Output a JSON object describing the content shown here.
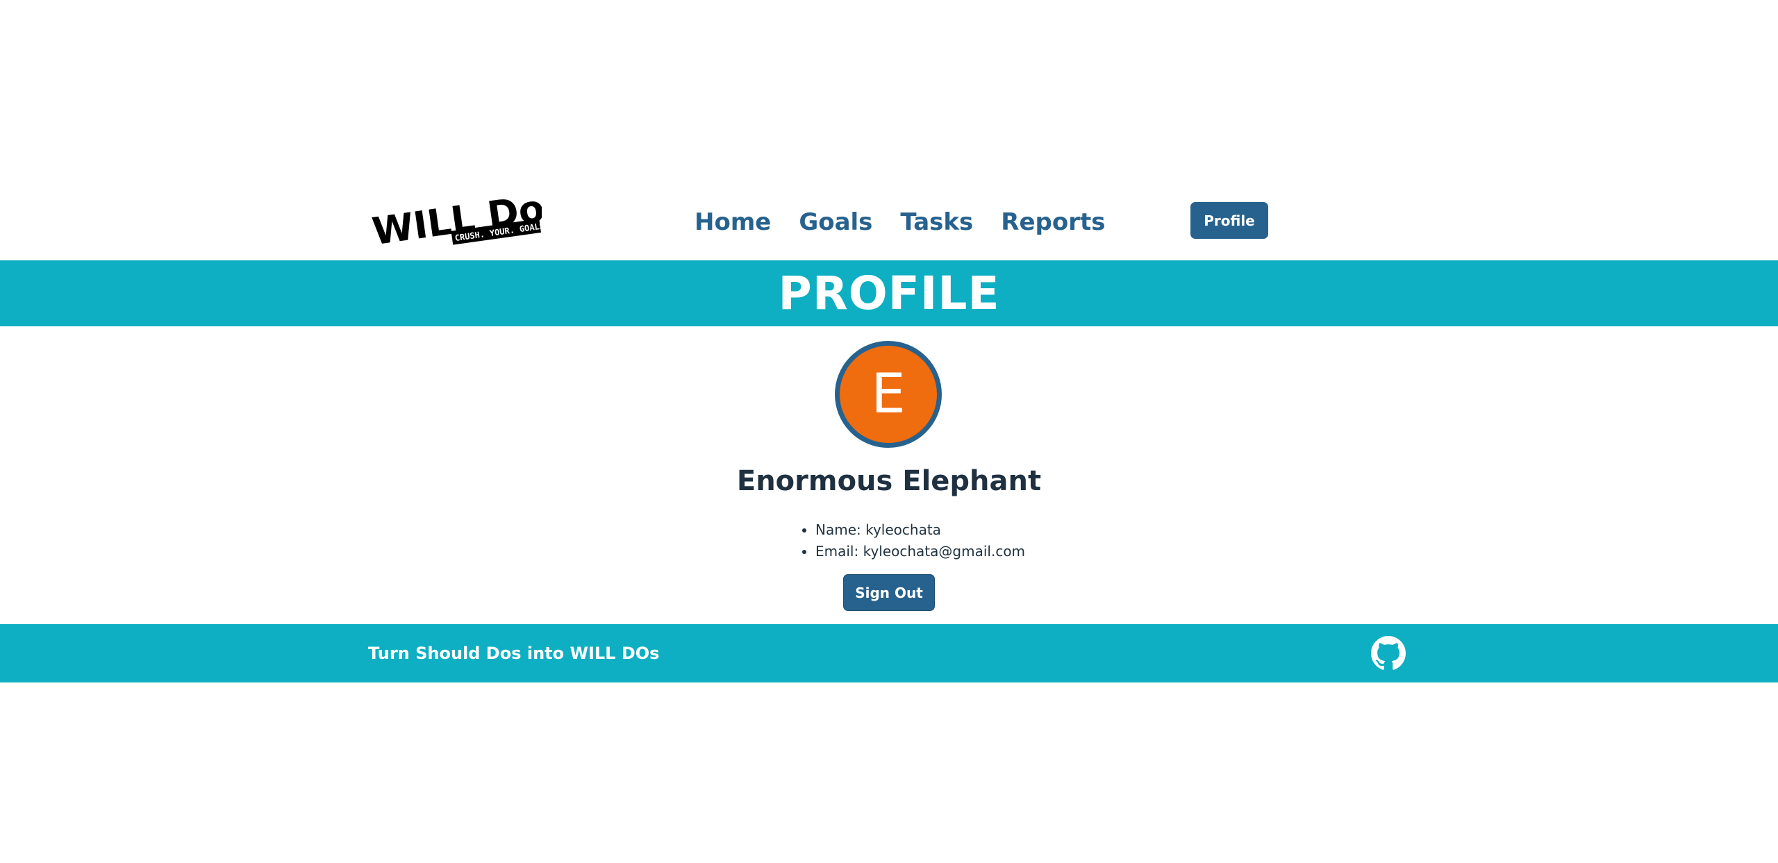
{
  "header": {
    "logo_text": "WILL Do",
    "logo_tagline": "CRUSH. YOUR. GOALS.",
    "nav": [
      {
        "label": "Home"
      },
      {
        "label": "Goals"
      },
      {
        "label": "Tasks"
      },
      {
        "label": "Reports"
      }
    ],
    "profile_button": "Profile"
  },
  "banner": {
    "title": "PROFILE"
  },
  "profile": {
    "avatar_initial": "E",
    "display_name": "Enormous Elephant",
    "name_line": "Name: kyleochata",
    "email_line": "Email: kyleochata@gmail.com",
    "sign_out": "Sign Out"
  },
  "footer": {
    "tagline": "Turn Should Dos into WILL DOs",
    "github_icon": "github-icon"
  },
  "colors": {
    "brand_teal": "#0eafc2",
    "brand_blue": "#27628e",
    "avatar_orange": "#ef6c0f"
  }
}
